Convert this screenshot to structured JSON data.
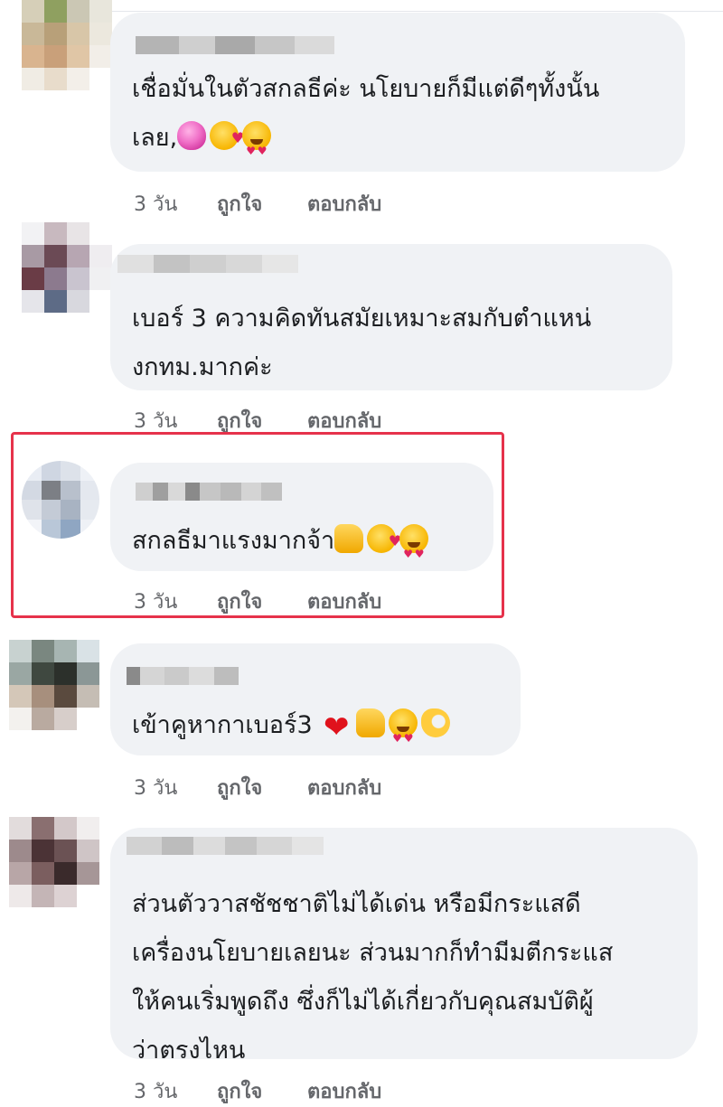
{
  "comments": [
    {
      "text_lines": [
        "เชื่อมั่นในตัวสกลธีค่ะ นโยบายก็มีแต่ดีๆทั้งนั้น",
        "เลย,"
      ],
      "emojis": [
        "pink-heart-emoji",
        "smiling-face-with-hearts-emoji",
        "heart-eyes-emoji"
      ],
      "time": "3 วัน",
      "like": "ถูกใจ",
      "reply": "ตอบกลับ"
    },
    {
      "text_lines": [
        "เบอร์ 3 ความคิดทันสมัยเหมาะสมกับตำแหน่",
        "งกทม.มากค่ะ"
      ],
      "emojis": [],
      "time": "3 วัน",
      "like": "ถูกใจ",
      "reply": "ตอบกลับ"
    },
    {
      "text_lines": [
        "สกลธีมาแรงมากจ้า"
      ],
      "emojis": [
        "thumbs-up-emoji",
        "smiling-face-with-hearts-emoji",
        "heart-eyes-emoji"
      ],
      "time": "3 วัน",
      "like": "ถูกใจ",
      "reply": "ตอบกลับ",
      "highlighted": true
    },
    {
      "text_lines": [
        "เข้าคูหากาเบอร์3"
      ],
      "emojis": [
        "red-heart-emoji",
        "thumbs-up-emoji",
        "heart-eyes-emoji",
        "ok-hand-emoji"
      ],
      "time": "3 วัน",
      "like": "ถูกใจ",
      "reply": "ตอบกลับ"
    },
    {
      "text_lines": [
        "ส่วนตัววาสชัชชาติไม่ได้เด่น หรือมีกระแสดี",
        "เครื่องนโยบายเลยนะ ส่วนมากก็ทำมีมตีกระแส",
        "ให้คนเริ่มพูดถึง ซึ่งก็ไม่ได้เกี่ยวกับคุณสมบัติผู้",
        "ว่าตรงไหน"
      ],
      "emojis": [],
      "time": "3 วัน",
      "like": "ถูกใจ",
      "reply": "ตอบกลับ"
    }
  ],
  "colors": {
    "bubble": "#f0f2f5",
    "meta_text": "#65676b",
    "highlight_border": "#e6324b"
  }
}
